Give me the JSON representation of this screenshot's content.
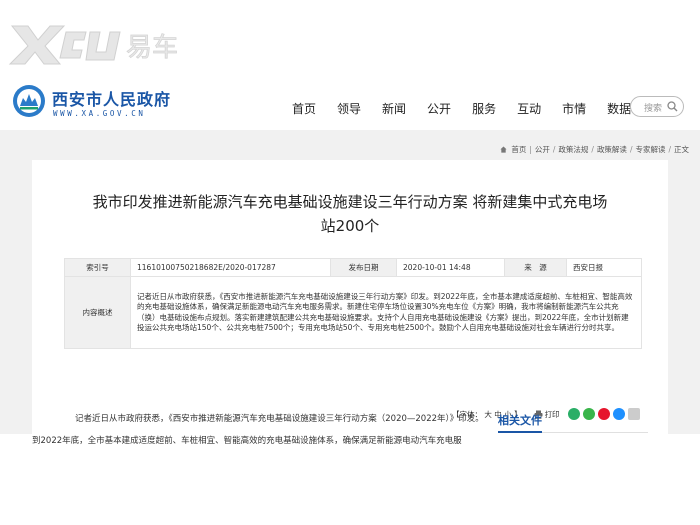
{
  "watermark": {
    "text": "易车"
  },
  "header": {
    "site_name": "西安市人民政府",
    "domain": "WWW.XA.GOV.CN"
  },
  "nav": [
    "首页",
    "领导",
    "新闻",
    "公开",
    "服务",
    "互动",
    "市情",
    "数据"
  ],
  "search": {
    "placeholder": "搜索",
    "icon": "search-icon"
  },
  "breadcrumb": [
    "首页",
    "公开",
    "政策法规",
    "政策解读",
    "专家解读",
    "正文"
  ],
  "article": {
    "title_line1": "我市印发推进新能源汽车充电基础设施建设三年行动方案 将新建集中式充电场",
    "title_line2": "站200个",
    "meta": {
      "index_label": "索引号",
      "index_value": "11610100750218682E/2020-017287",
      "date_label": "发布日期",
      "date_value": "2020-10-01 14:48",
      "source_label": "来　源",
      "source_value": "西安日报",
      "summary_label": "内容概述",
      "summary_value": "记者近日从市政府获悉，《西安市推进新能源汽车充电基础设施建设三年行动方案》印发。到2022年底，全市基本建成适度超前、车桩相宜、智能高效的充电基础设施体系，确保满足新能源电动汽车充电服务需求。新建住宅停车场位设置30%充电车位《方案》明确，我市将编制新能源汽车公共充（换）电基础设施布点规划。落实新建建筑配建公共充电基础设施要求。支持个人自用充电基础设施建设《方案》提出，到2022年底，全市计划新建投运公共充电场站150个、公共充电桩7500个；专用充电场站50个、专用充电桩2500个。鼓励个人自用充电基础设施对社会车辆进行分时共享。"
    },
    "font_size_label": "【字体：",
    "font_sizes": [
      "大",
      "中",
      "小"
    ],
    "font_size_end": "】",
    "print_label": "打印",
    "body_p1": "记者近日从市政府获悉，《西安市推进新能源汽车充电基础设施建设三年行动方案（2020—2022年）》印发。",
    "body_p2": "到2022年底，全市基本建成适度超前、车桩相宜、智能高效的充电基础设施体系，确保满足新能源电动汽车充电服"
  },
  "related": {
    "title": "相关文件"
  },
  "colors": {
    "brand": "#1a56a6",
    "page_bg": "#f1f1f1"
  }
}
